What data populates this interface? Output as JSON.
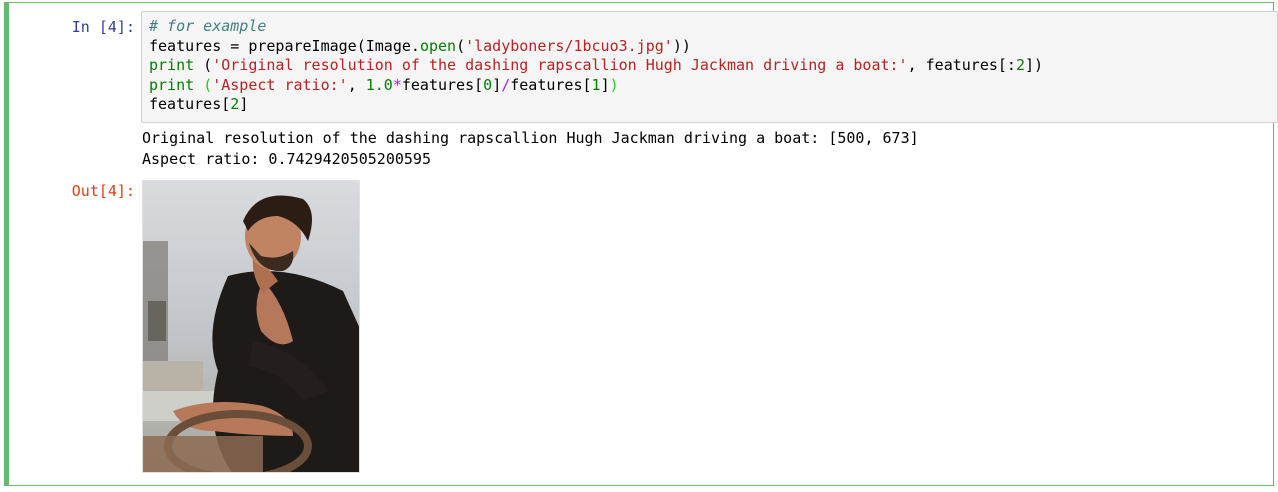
{
  "cell": {
    "in_prompt": "In [4]:",
    "out_prompt": "Out[4]:",
    "code_lines": [
      [
        {
          "text": "# for example",
          "cls": "cm-comment"
        }
      ],
      [
        {
          "text": "features = prepareImage(Image.",
          "cls": ""
        },
        {
          "text": "open",
          "cls": "cm-builtin"
        },
        {
          "text": "(",
          "cls": ""
        },
        {
          "text": "'ladyboners/1bcuo3.jpg'",
          "cls": "cm-string"
        },
        {
          "text": "))",
          "cls": ""
        }
      ],
      [
        {
          "text": "print",
          "cls": "cm-builtin"
        },
        {
          "text": " (",
          "cls": ""
        },
        {
          "text": "'Original resolution of the dashing rapscallion Hugh Jackman driving a boat:'",
          "cls": "cm-string"
        },
        {
          "text": ", features[:",
          "cls": ""
        },
        {
          "text": "2",
          "cls": "cm-number"
        },
        {
          "text": "])",
          "cls": ""
        }
      ],
      [
        {
          "text": "print",
          "cls": "cm-builtin"
        },
        {
          "text": " ",
          "cls": ""
        },
        {
          "text": "(",
          "cls": "cm-paren-green"
        },
        {
          "text": "'Aspect ratio:'",
          "cls": "cm-string"
        },
        {
          "text": ", ",
          "cls": ""
        },
        {
          "text": "1.0",
          "cls": "cm-number"
        },
        {
          "text": "*",
          "cls": "cm-op"
        },
        {
          "text": "features[",
          "cls": ""
        },
        {
          "text": "0",
          "cls": "cm-number"
        },
        {
          "text": "]",
          "cls": ""
        },
        {
          "text": "/",
          "cls": "cm-op"
        },
        {
          "text": "features[",
          "cls": ""
        },
        {
          "text": "1",
          "cls": "cm-number"
        },
        {
          "text": "]",
          "cls": ""
        },
        {
          "text": ")",
          "cls": "cm-paren-green"
        }
      ],
      [
        {
          "text": "features[",
          "cls": ""
        },
        {
          "text": "2",
          "cls": "cm-number"
        },
        {
          "text": "]",
          "cls": ""
        }
      ]
    ],
    "stdout_lines": [
      "Original resolution of the dashing rapscallion Hugh Jackman driving a boat: [500, 673]",
      "Aspect ratio: 0.7429420505200595"
    ]
  },
  "colors": {
    "cell_border": "#66bb6a",
    "in_prompt": "#303f9f",
    "out_prompt": "#d84315",
    "input_bg": "#f5f5f5"
  }
}
